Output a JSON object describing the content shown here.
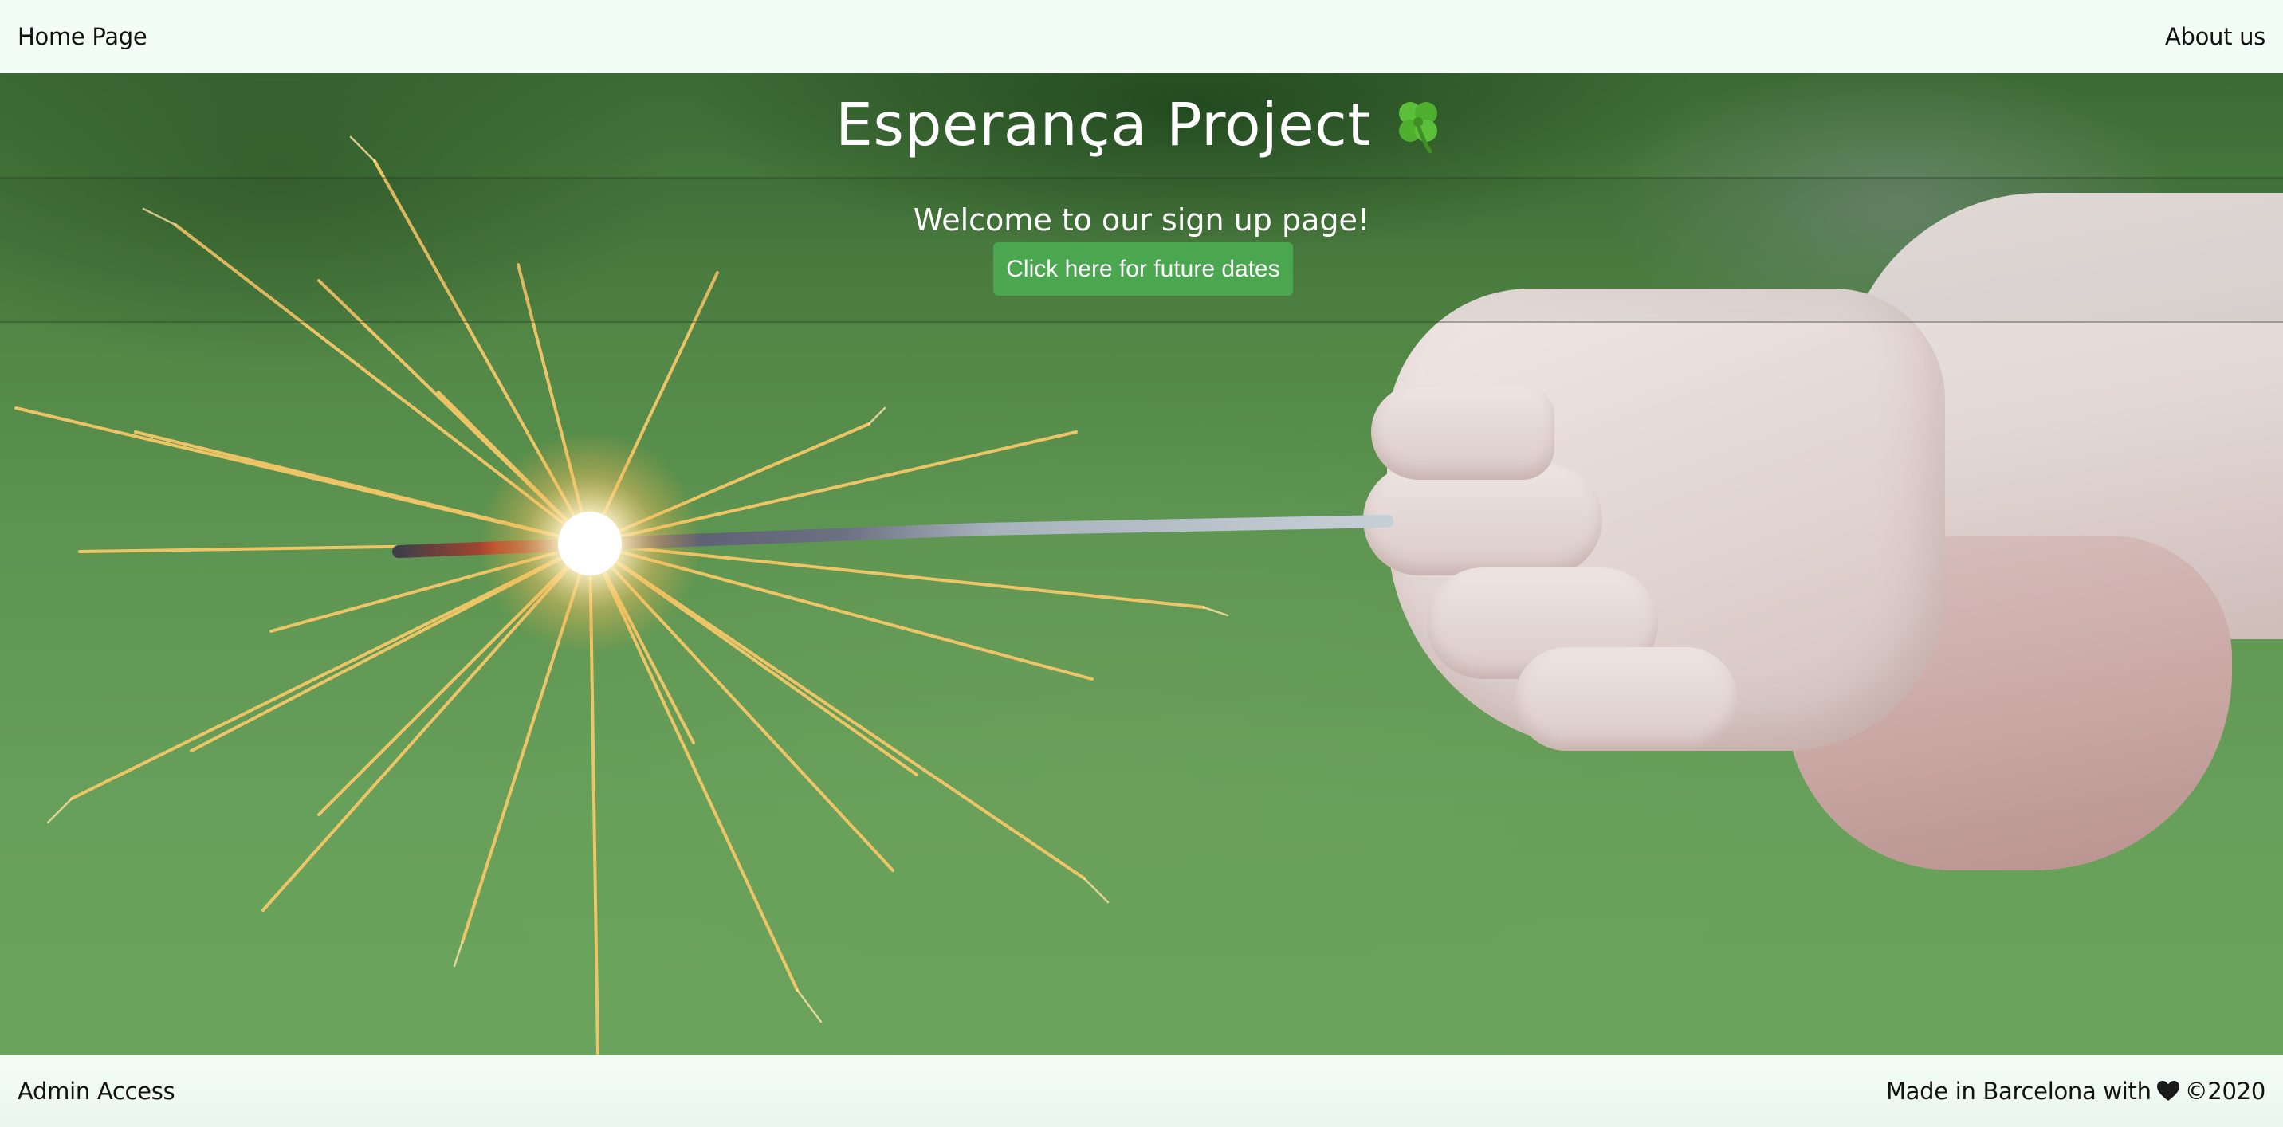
{
  "nav": {
    "home_label": "Home Page",
    "about_label": "About us"
  },
  "hero": {
    "title": "Esperança Project",
    "title_icon": "four-leaf-clover-icon",
    "welcome": "Welcome to our sign up page!",
    "cta_label": "Click here for future dates",
    "background_image": "child hand holding lit sparkler against green background"
  },
  "footer": {
    "admin_label": "Admin Access",
    "credit_prefix": "Made in Barcelona with",
    "credit_icon": "black-heart-icon",
    "credit_suffix": "©2020"
  },
  "colors": {
    "nav_background": "#f1fdf5",
    "button_green": "#4aa64f",
    "title_text": "#ffffff"
  }
}
